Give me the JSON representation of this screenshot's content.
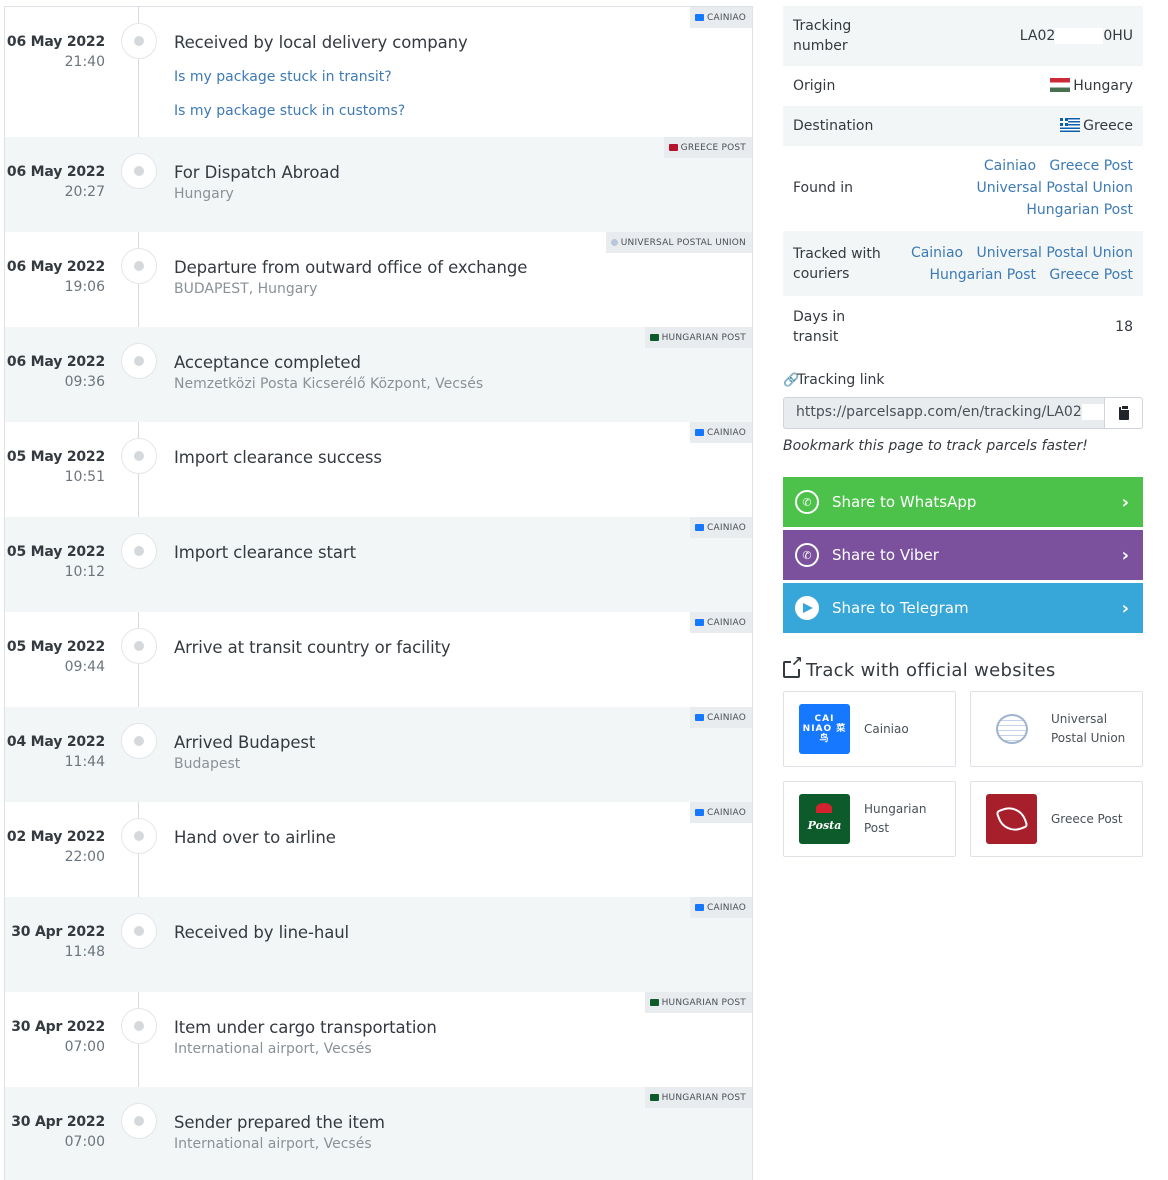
{
  "events": [
    {
      "date": "06 May 2022",
      "time": "21:40",
      "status": "Received by local delivery company",
      "location": "",
      "courier": "CAINIAO",
      "links": [
        "Is my package stuck in transit?",
        "Is my package stuck in customs?"
      ]
    },
    {
      "date": "06 May 2022",
      "time": "20:27",
      "status": "For Dispatch Abroad",
      "location": "Hungary",
      "courier": "GREECE POST"
    },
    {
      "date": "06 May 2022",
      "time": "19:06",
      "status": "Departure from outward office of exchange",
      "location": "BUDAPEST, Hungary",
      "courier": "UNIVERSAL POSTAL UNION"
    },
    {
      "date": "06 May 2022",
      "time": "09:36",
      "status": "Acceptance completed",
      "location": "Nemzetközi Posta Kicserélő Központ, Vecsés",
      "courier": "HUNGARIAN POST"
    },
    {
      "date": "05 May 2022",
      "time": "10:51",
      "status": "Import clearance success",
      "location": "",
      "courier": "CAINIAO"
    },
    {
      "date": "05 May 2022",
      "time": "10:12",
      "status": "Import clearance start",
      "location": "",
      "courier": "CAINIAO"
    },
    {
      "date": "05 May 2022",
      "time": "09:44",
      "status": "Arrive at transit country or facility",
      "location": "",
      "courier": "CAINIAO"
    },
    {
      "date": "04 May 2022",
      "time": "11:44",
      "status": "Arrived Budapest",
      "location": "Budapest",
      "courier": "CAINIAO"
    },
    {
      "date": "02 May 2022",
      "time": "22:00",
      "status": "Hand over to airline",
      "location": "",
      "courier": "CAINIAO"
    },
    {
      "date": "30 Apr 2022",
      "time": "11:48",
      "status": "Received by line-haul",
      "location": "",
      "courier": "CAINIAO"
    },
    {
      "date": "30 Apr 2022",
      "time": "07:00",
      "status": "Item under cargo transportation",
      "location": "International airport, Vecsés",
      "courier": "HUNGARIAN POST"
    },
    {
      "date": "30 Apr 2022",
      "time": "07:00",
      "status": "Sender prepared the item",
      "location": "International airport, Vecsés",
      "courier": "HUNGARIAN POST"
    }
  ],
  "info": {
    "tracking_label": "Tracking number",
    "tracking_prefix": "LA02",
    "tracking_suffix": "0HU",
    "origin_label": "Origin",
    "origin_value": "Hungary",
    "destination_label": "Destination",
    "destination_value": "Greece",
    "found_in_label": "Found in",
    "found_in": [
      "Cainiao",
      "Greece Post",
      "Universal Postal Union",
      "Hungarian Post"
    ],
    "tracked_with_label": "Tracked with couriers",
    "tracked_with": [
      "Cainiao",
      "Universal Postal Union",
      "Hungarian Post",
      "Greece Post"
    ],
    "days_label": "Days in transit",
    "days_value": "18"
  },
  "tracking_link": {
    "label": "Tracking link",
    "url": "https://parcelsapp.com/en/tracking/LA02",
    "bookmark_hint": "Bookmark this page to track parcels faster!"
  },
  "share": {
    "whatsapp": "Share to WhatsApp",
    "viber": "Share to Viber",
    "telegram": "Share to Telegram"
  },
  "official": {
    "title": "Track with official websites",
    "sites": [
      {
        "name": "Cainiao",
        "logo_text": "CAI NIAO 菜鸟"
      },
      {
        "name": "Universal Postal Union"
      },
      {
        "name": "Hungarian Post",
        "logo_text": "Posta"
      },
      {
        "name": "Greece Post"
      }
    ]
  },
  "colors": {
    "link": "#3d7ab5",
    "whatsapp": "#4cc24a",
    "viber": "#7b519d",
    "telegram": "#37a6d9",
    "row_shade": "#f2f6f7"
  }
}
